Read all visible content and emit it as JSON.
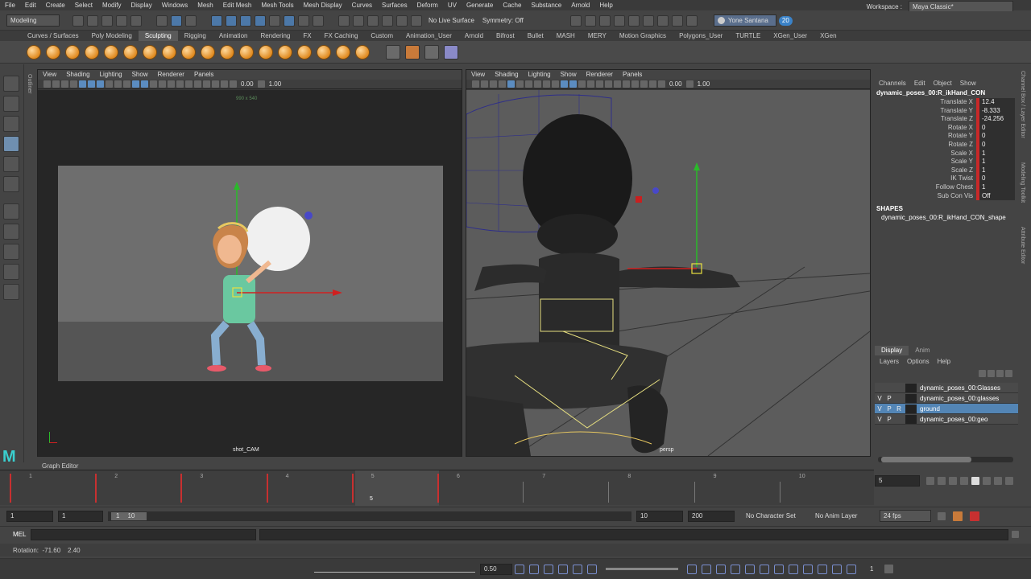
{
  "menubar": {
    "items": [
      "File",
      "Edit",
      "Create",
      "Select",
      "Modify",
      "Display",
      "Windows",
      "Mesh",
      "Edit Mesh",
      "Mesh Tools",
      "Mesh Display",
      "Curves",
      "Surfaces",
      "Deform",
      "UV",
      "Generate",
      "Cache",
      "Substance",
      "Arnold",
      "Help"
    ],
    "workspace_label": "Workspace :",
    "workspace_value": "Maya Classic*"
  },
  "statusline": {
    "mode": "Modeling",
    "live_surface": "No Live Surface",
    "symmetry": "Symmetry: Off",
    "user": "Yone Santana",
    "badge": "20"
  },
  "shelf": {
    "tabs": [
      "Curves / Surfaces",
      "Poly Modeling",
      "Sculpting",
      "Rigging",
      "Animation",
      "Rendering",
      "FX",
      "FX Caching",
      "Custom",
      "Animation_User",
      "Arnold",
      "Bifrost",
      "Bullet",
      "MASH",
      "MERY",
      "Motion Graphics",
      "Polygons_User",
      "TURTLE",
      "XGen_User",
      "XGen"
    ],
    "active_tab": "Sculpting"
  },
  "toolbox": {
    "outliner_label": "Outliner"
  },
  "viewport_left": {
    "menu": [
      "View",
      "Shading",
      "Lighting",
      "Show",
      "Renderer",
      "Panels"
    ],
    "num1": "0.00",
    "num2": "1.00",
    "camera": "shot_CAM",
    "hud_top": "990 x 540"
  },
  "viewport_right": {
    "menu": [
      "View",
      "Shading",
      "Lighting",
      "Show",
      "Renderer",
      "Panels"
    ],
    "num1": "0.00",
    "num2": "1.00",
    "camera": "persp"
  },
  "channelbox": {
    "menu": [
      "Channels",
      "Edit",
      "Object",
      "Show"
    ],
    "object": "dynamic_poses_00:R_ikHand_CON",
    "channels": [
      {
        "label": "Translate X",
        "value": "12.4"
      },
      {
        "label": "Translate Y",
        "value": "-8.333"
      },
      {
        "label": "Translate Z",
        "value": "-24.256"
      },
      {
        "label": "Rotate X",
        "value": "0"
      },
      {
        "label": "Rotate Y",
        "value": "0"
      },
      {
        "label": "Rotate Z",
        "value": "0"
      },
      {
        "label": "Scale X",
        "value": "1"
      },
      {
        "label": "Scale Y",
        "value": "1"
      },
      {
        "label": "Scale Z",
        "value": "1"
      },
      {
        "label": "IK Twist",
        "value": "0"
      },
      {
        "label": "Follow Chest",
        "value": "1"
      },
      {
        "label": "Sub Con Vis",
        "value": "Off"
      }
    ],
    "shapes_header": "SHAPES",
    "shape_name": "dynamic_poses_00:R_ikHand_CON_shape",
    "side_tabs": [
      "Channel Box / Layer Editor",
      "Modeling Toolkit",
      "Attribute Editor"
    ]
  },
  "layereditor": {
    "tabs": [
      "Display",
      "Anim"
    ],
    "menu": [
      "Layers",
      "Options",
      "Help"
    ],
    "layers": [
      {
        "v": "",
        "p": "",
        "r": "",
        "name": "dynamic_poses_00:Glasses"
      },
      {
        "v": "V",
        "p": "P",
        "r": "",
        "name": "dynamic_poses_00:glasses"
      },
      {
        "v": "V",
        "p": "P",
        "r": "R",
        "name": "ground"
      },
      {
        "v": "V",
        "p": "P",
        "r": "",
        "name": "dynamic_poses_00:geo"
      }
    ]
  },
  "graph_editor_label": "Graph Editor",
  "timeline": {
    "labels": [
      "1",
      "2",
      "3",
      "4",
      "5",
      "6",
      "7",
      "8",
      "9",
      "10"
    ],
    "current_frame": "5",
    "current_field": "5"
  },
  "rangebar": {
    "start": "1",
    "start2": "1",
    "range_inner_a": "1",
    "range_inner_b": "10",
    "end": "10",
    "end2": "200",
    "character_set": "No Character Set",
    "anim_layer": "No Anim Layer",
    "fps": "24 fps"
  },
  "mel": {
    "label": "MEL"
  },
  "helpline": {
    "text": "Rotation:  -71.60    2.40"
  },
  "bottombar": {
    "value": "0.50",
    "page": "1"
  }
}
